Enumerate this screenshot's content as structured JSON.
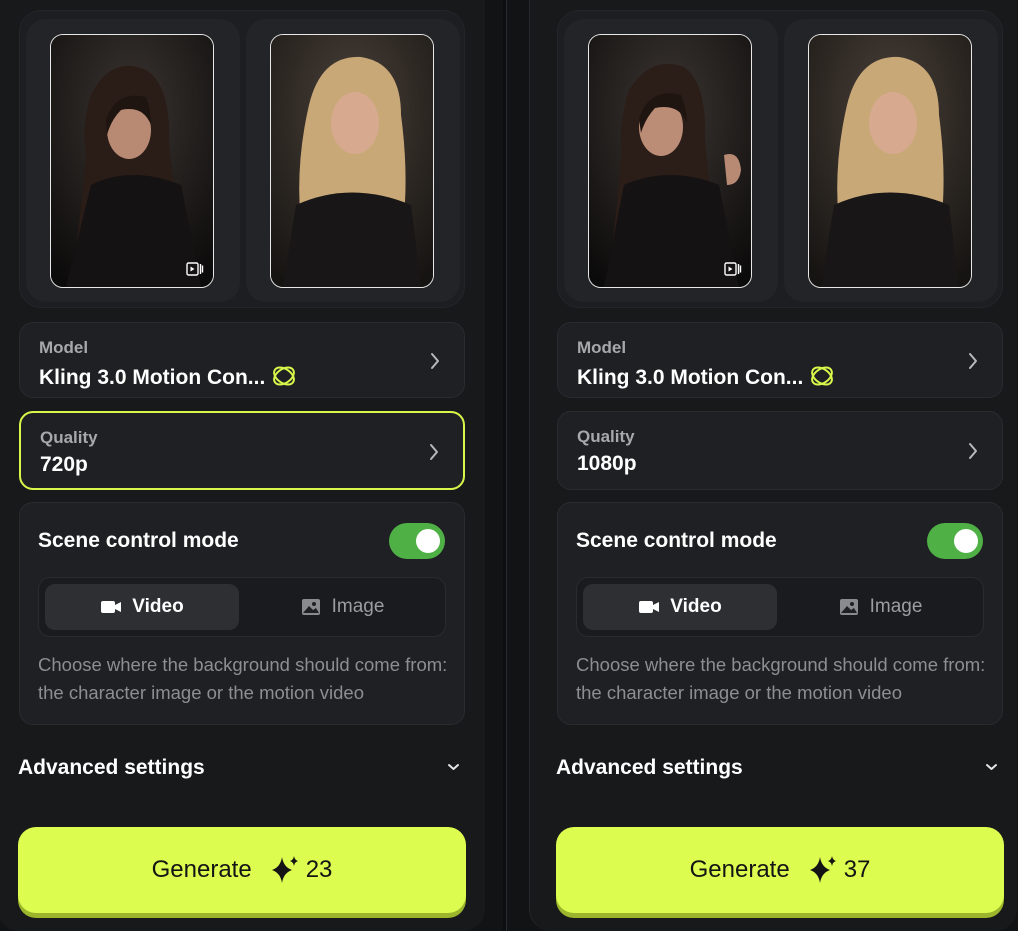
{
  "panels": [
    {
      "media": {
        "motion_thumb": "video-thumbnail",
        "character_thumb": "character-image"
      },
      "model": {
        "label": "Model",
        "value": "Kling 3.0 Motion Con...",
        "icon": "kling-logo-icon"
      },
      "quality": {
        "label": "Quality",
        "value": "720p",
        "selected": true
      },
      "scene_control": {
        "title": "Scene control mode",
        "enabled": true,
        "options": [
          "Video",
          "Image"
        ],
        "selected": "Video",
        "description": "Choose where the background should come from: the character image or the motion video"
      },
      "advanced": {
        "label": "Advanced settings"
      },
      "generate": {
        "label": "Generate",
        "credits": "23"
      }
    },
    {
      "media": {
        "motion_thumb": "video-thumbnail",
        "character_thumb": "character-image"
      },
      "model": {
        "label": "Model",
        "value": "Kling 3.0 Motion Con...",
        "icon": "kling-logo-icon"
      },
      "quality": {
        "label": "Quality",
        "value": "1080p",
        "selected": false
      },
      "scene_control": {
        "title": "Scene control mode",
        "enabled": true,
        "options": [
          "Video",
          "Image"
        ],
        "selected": "Video",
        "description": "Choose where the background should come from: the character image or the motion video"
      },
      "advanced": {
        "label": "Advanced settings"
      },
      "generate": {
        "label": "Generate",
        "credits": "37"
      }
    }
  ],
  "colors": {
    "accent": "#dcfc4f",
    "toggle_on": "#4fb045",
    "panel_bg": "#18191b",
    "card_bg": "#1f2023"
  }
}
